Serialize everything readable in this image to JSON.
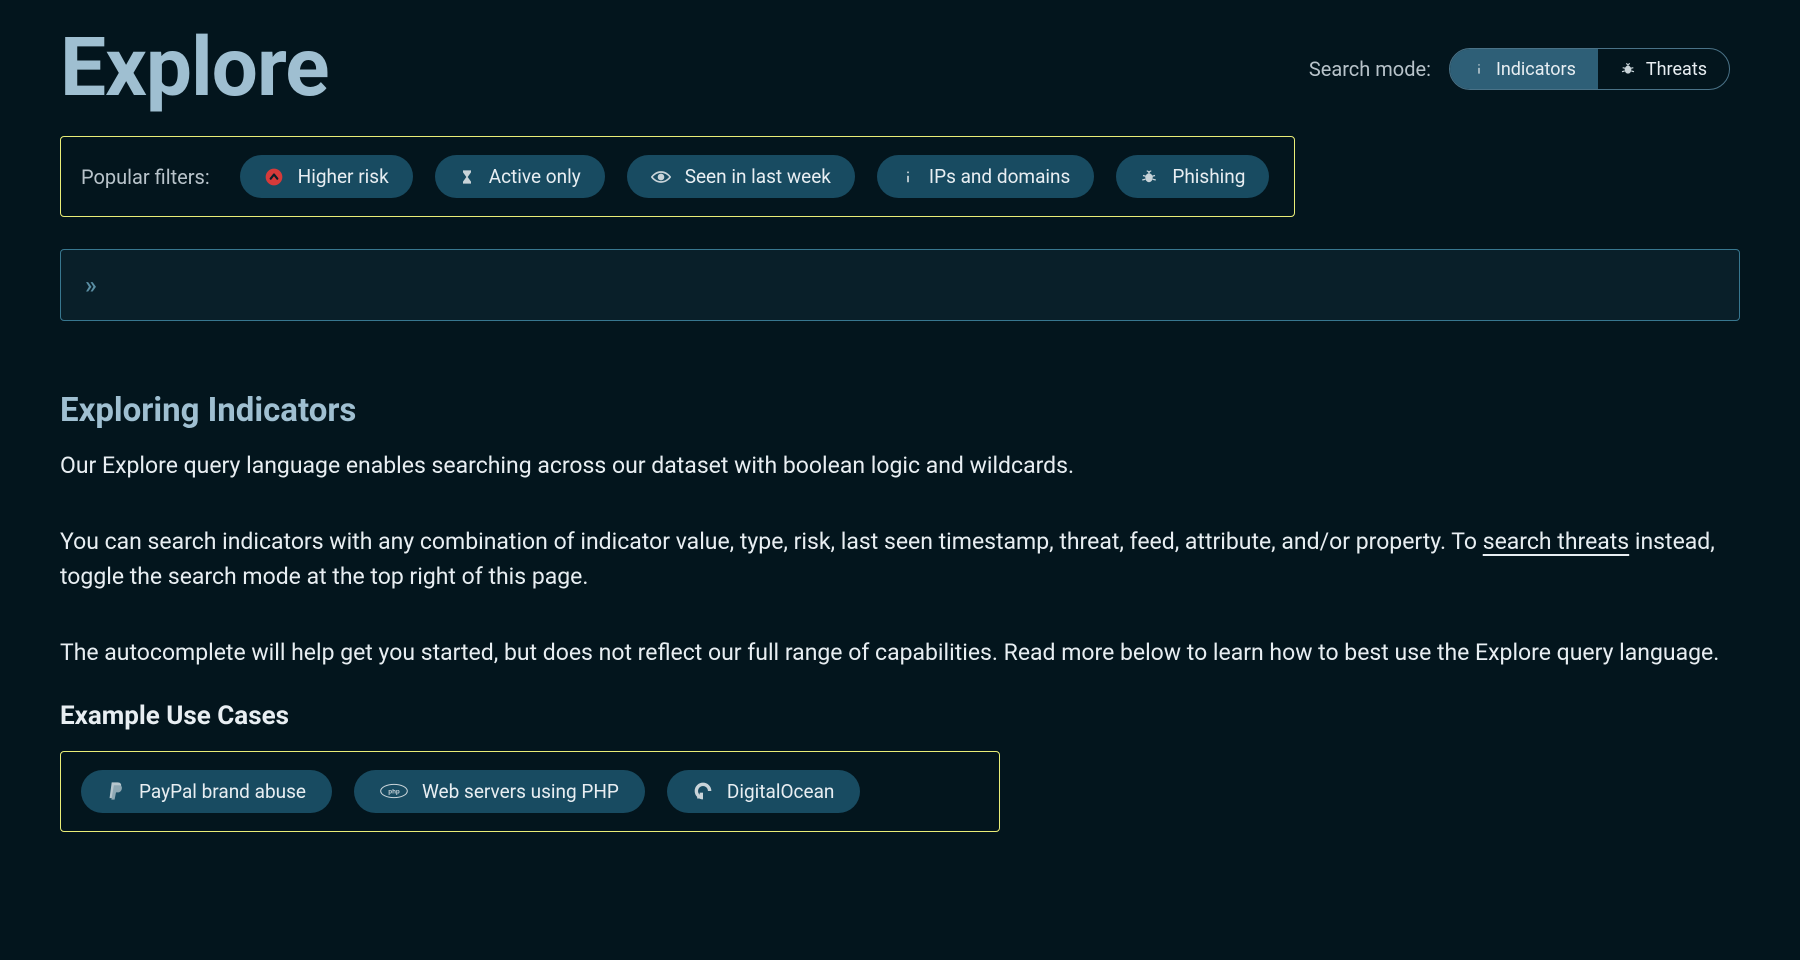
{
  "header": {
    "title": "Explore",
    "mode_label": "Search mode:",
    "mode_options": {
      "indicators": "Indicators",
      "threats": "Threats"
    }
  },
  "filters": {
    "label": "Popular filters:",
    "items": [
      {
        "icon": "red-up-icon",
        "label": "Higher risk"
      },
      {
        "icon": "hourglass-icon",
        "label": "Active only"
      },
      {
        "icon": "eye-icon",
        "label": "Seen in last week"
      },
      {
        "icon": "info-icon",
        "label": "IPs and domains"
      },
      {
        "icon": "bug-icon",
        "label": "Phishing"
      }
    ]
  },
  "search": {
    "prompt": "»"
  },
  "content": {
    "heading": "Exploring Indicators",
    "p1": "Our Explore query language enables searching across our dataset with boolean logic and wildcards.",
    "p2a": "You can search indicators with any combination of indicator value, type, risk, last seen timestamp, threat, feed, attribute, and/or property. To ",
    "p2_link": "search threats",
    "p2b": " instead, toggle the search mode at the top right of this page.",
    "p3": "The autocomplete will help get you started, but does not reflect our full range of capabilities. Read more below to learn how to best use the Explore query language."
  },
  "usecases": {
    "heading": "Example Use Cases",
    "items": [
      {
        "icon": "paypal-icon",
        "label": "PayPal brand abuse"
      },
      {
        "icon": "php-icon",
        "label": "Web servers using PHP"
      },
      {
        "icon": "digitalocean-icon",
        "label": "DigitalOcean"
      }
    ]
  }
}
